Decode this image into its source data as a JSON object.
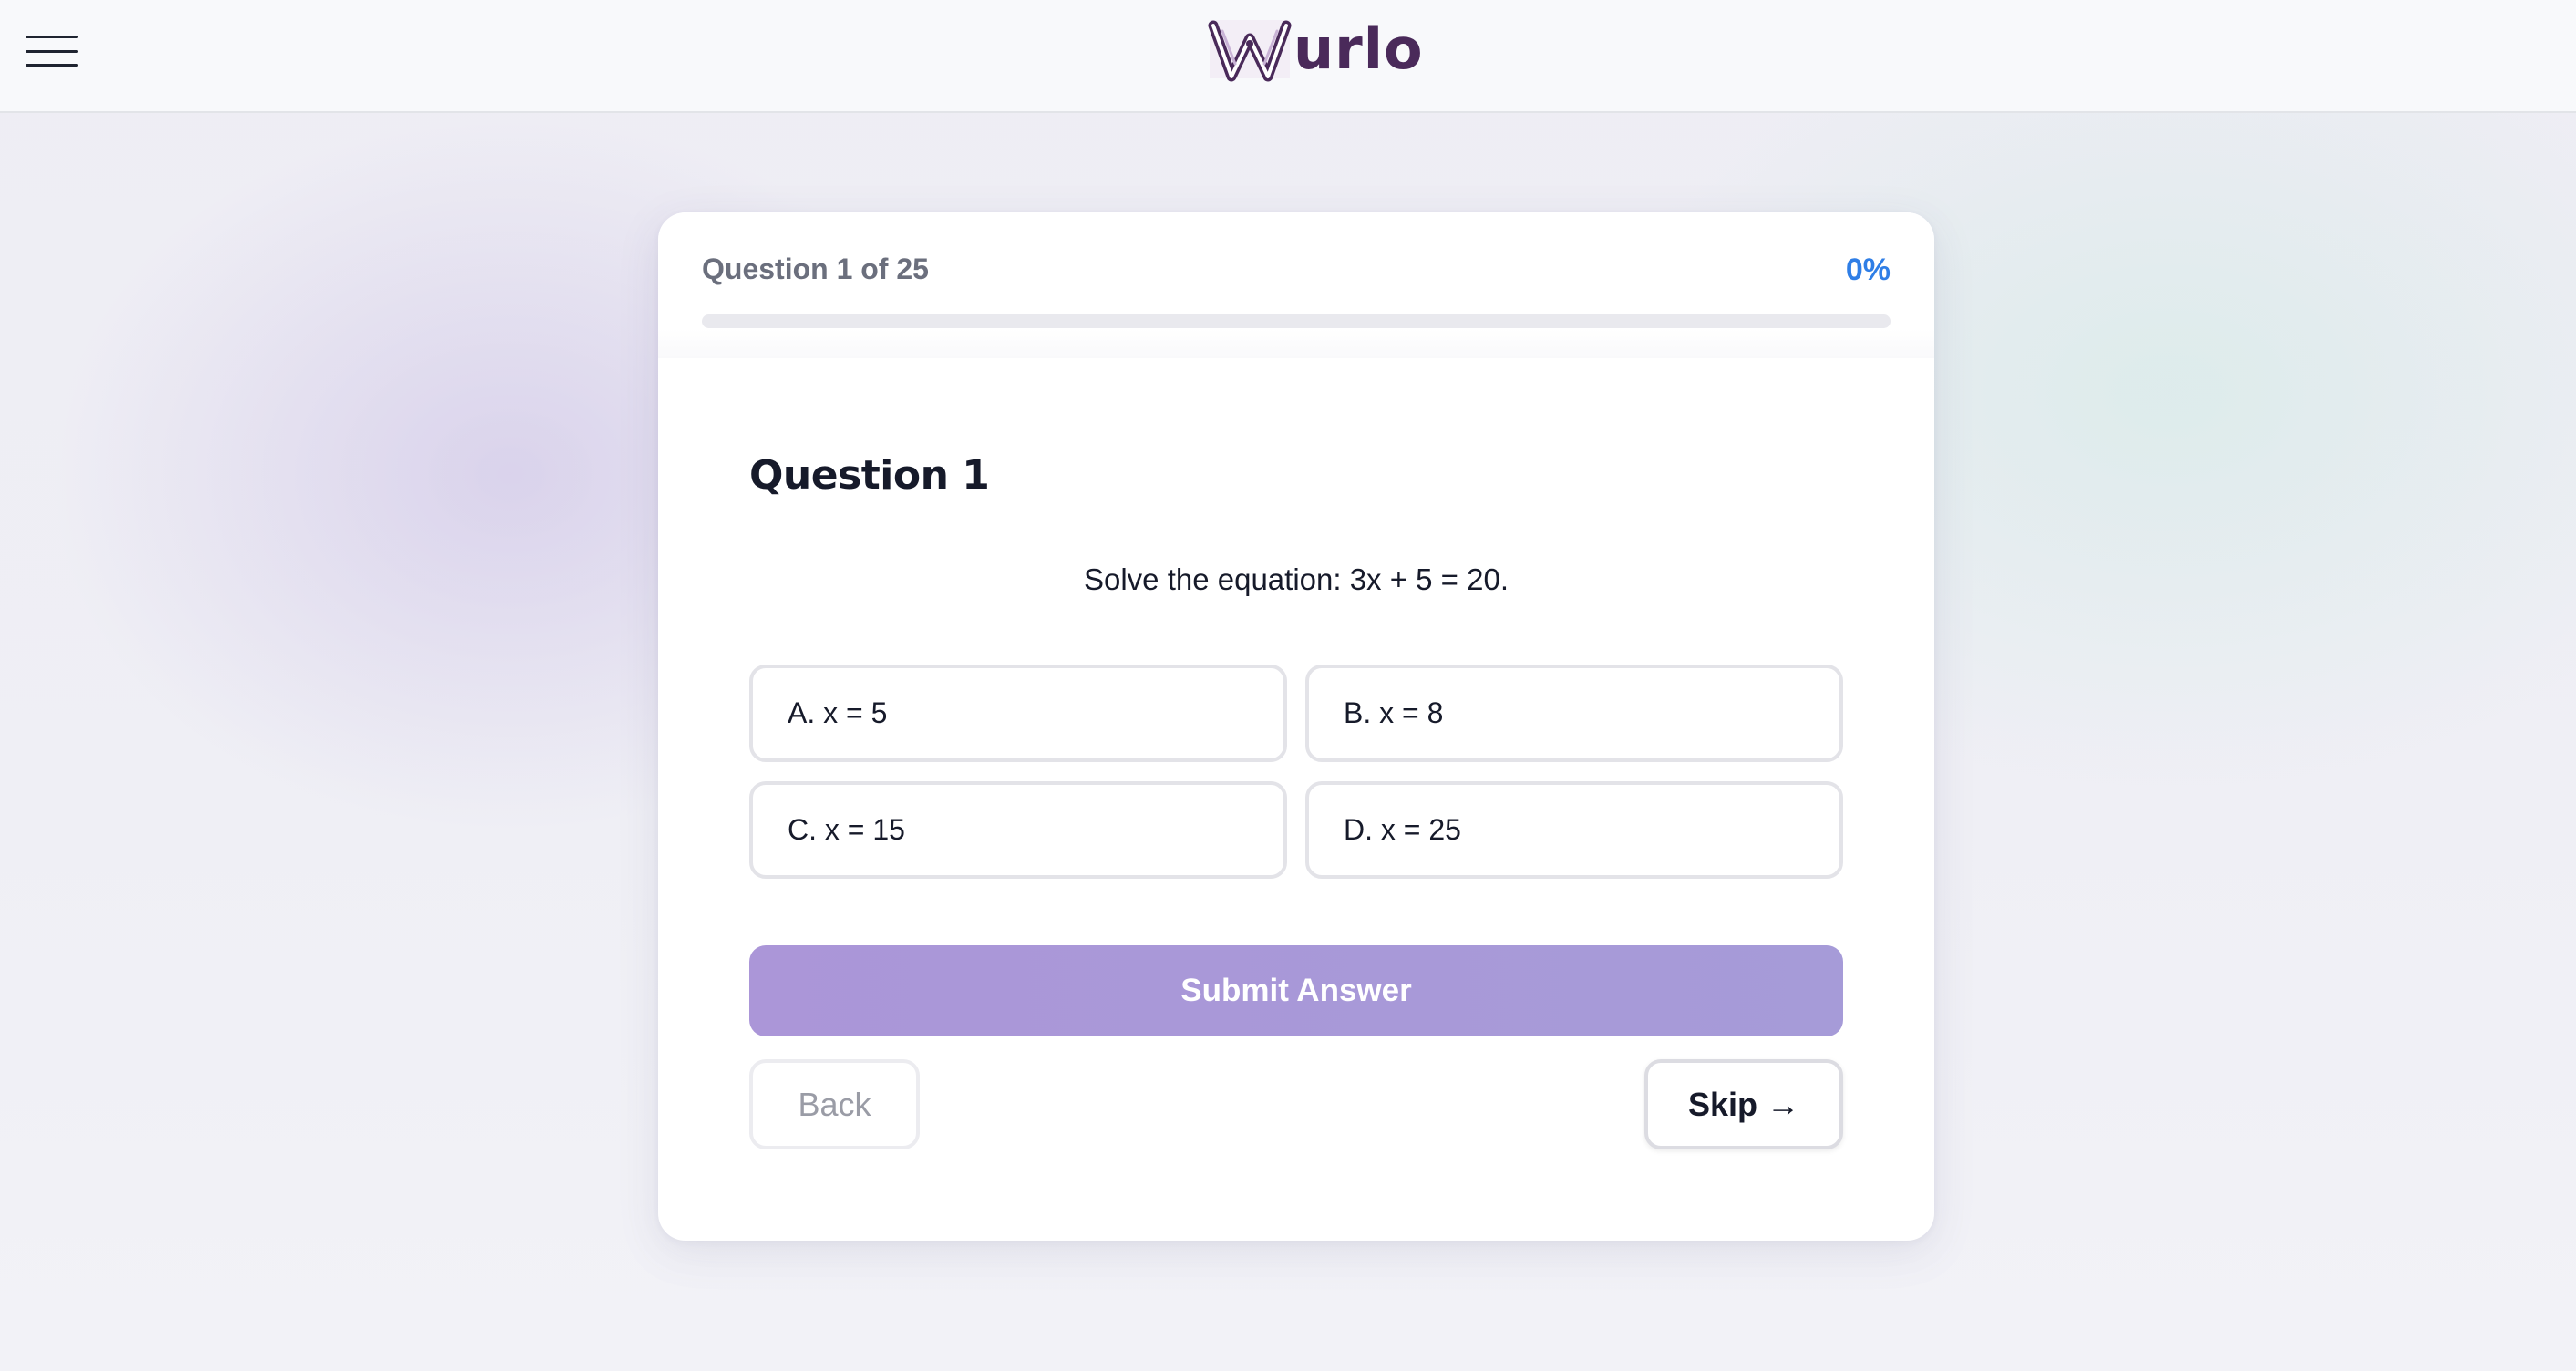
{
  "app": {
    "logo_text": "urlo",
    "logo_mark": "W-monogram-logo"
  },
  "header": {
    "menu_icon": "hamburger-menu-icon"
  },
  "quiz": {
    "question_counter": "Question 1 of 25",
    "progress_label": "0%",
    "progress_value": 0,
    "question_title": "Question 1",
    "question_text": "Solve the equation: 3x + 5 = 20.",
    "options": [
      {
        "label": "A. x = 5"
      },
      {
        "label": "B. x = 8"
      },
      {
        "label": "C. x = 15"
      },
      {
        "label": "D. x = 25"
      }
    ],
    "submit_label": "Submit Answer",
    "back_label": "Back",
    "skip_label": "Skip",
    "skip_arrow": "→"
  },
  "colors": {
    "accent_blue": "#2f7ee6",
    "submit_purple": "#a99ad8",
    "logo_purple": "#4a2a5a"
  }
}
